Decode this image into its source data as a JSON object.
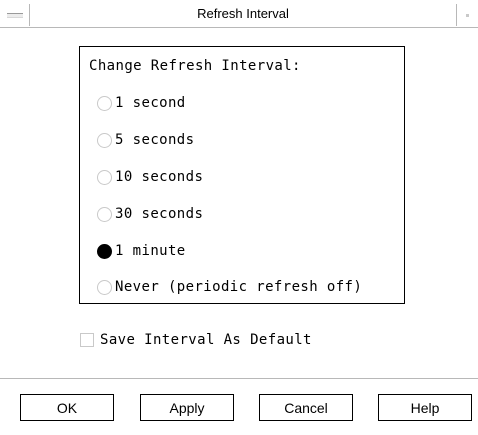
{
  "window": {
    "title": "Refresh Interval"
  },
  "group": {
    "title": "Change Refresh Interval:",
    "options": [
      {
        "label": "1 second",
        "selected": false
      },
      {
        "label": "5 seconds",
        "selected": false
      },
      {
        "label": "10 seconds",
        "selected": false
      },
      {
        "label": "30 seconds",
        "selected": false
      },
      {
        "label": "1 minute",
        "selected": true
      },
      {
        "label": "Never (periodic refresh off)",
        "selected": false
      }
    ]
  },
  "save_default": {
    "label": "Save Interval As Default",
    "checked": false
  },
  "buttons": {
    "ok": "OK",
    "apply": "Apply",
    "cancel": "Cancel",
    "help": "Help"
  }
}
